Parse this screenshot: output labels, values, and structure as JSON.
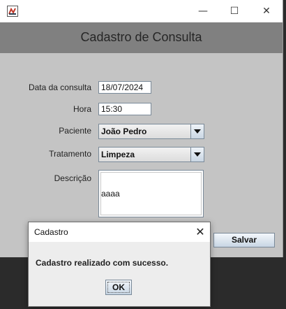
{
  "window": {
    "minimize_glyph": "—",
    "maximize_glyph": "☐",
    "close_glyph": "✕"
  },
  "header": {
    "title": "Cadastro de Consulta"
  },
  "form": {
    "date_label": "Data da consulta",
    "date_value": "18/07/2024",
    "time_label": "Hora",
    "time_value": "15:30",
    "patient_label": "Paciente",
    "patient_value": "João Pedro",
    "treatment_label": "Tratamento",
    "treatment_value": "Limpeza",
    "description_label": "Descrição",
    "description_value": "aaaa",
    "save_label": "Salvar"
  },
  "dialog": {
    "title": "Cadastro",
    "close_glyph": "✕",
    "message": "Cadastro realizado com sucesso.",
    "ok_label": "OK"
  },
  "colors": {
    "window_bg": "#c4c4c4",
    "header_bg": "#808080",
    "desktop_bg": "#2b2b2b"
  }
}
